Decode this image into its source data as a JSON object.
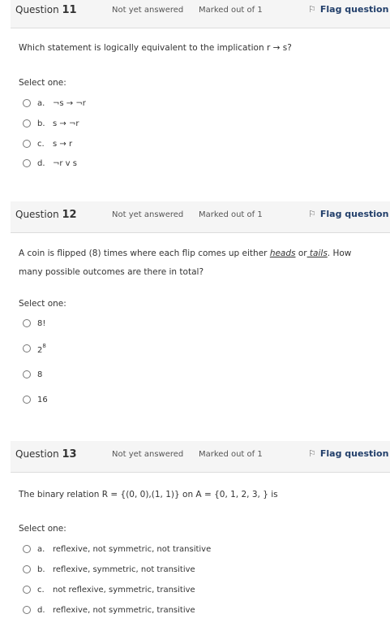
{
  "questions": [
    {
      "number_label": "Question",
      "number": "11",
      "status": "Not yet answered",
      "mark": "Marked out of 1",
      "flag_label": "Flag question",
      "text": "Which statement is logically equivalent to the implication r → s?",
      "select_label": "Select one:",
      "options": [
        {
          "letter": "a.",
          "text": "¬s → ¬r"
        },
        {
          "letter": "b.",
          "text": "s → ¬r"
        },
        {
          "letter": "c.",
          "text": "s → r"
        },
        {
          "letter": "d.",
          "text": "¬r v s"
        }
      ]
    },
    {
      "number_label": "Question",
      "number": "12",
      "status": "Not yet answered",
      "mark": "Marked out of 1",
      "flag_label": "Flag question",
      "text_pre": "A coin is flipped (8) times where each flip comes up either ",
      "text_heads": "heads",
      "text_or": " or",
      "text_tails": " tails",
      "text_post": ". How many possible outcomes are there in total?",
      "select_label": "Select one:",
      "options": [
        {
          "text": "8!"
        },
        {
          "base": "2",
          "exp": "8"
        },
        {
          "text": "8"
        },
        {
          "text": "16"
        }
      ]
    },
    {
      "number_label": "Question",
      "number": "13",
      "status": "Not yet answered",
      "mark": "Marked out of 1",
      "flag_label": "Flag question",
      "text": "The binary relation R = {(0, 0),(1, 1)} on A = {0, 1, 2, 3, } is",
      "select_label": "Select one:",
      "options": [
        {
          "letter": "a.",
          "text": "reflexive, not symmetric, not transitive"
        },
        {
          "letter": "b.",
          "text": "reflexive, symmetric, not transitive"
        },
        {
          "letter": "c.",
          "text": "not reflexive, symmetric, transitive"
        },
        {
          "letter": "d.",
          "text": "reflexive, not symmetric, transitive"
        }
      ]
    }
  ]
}
